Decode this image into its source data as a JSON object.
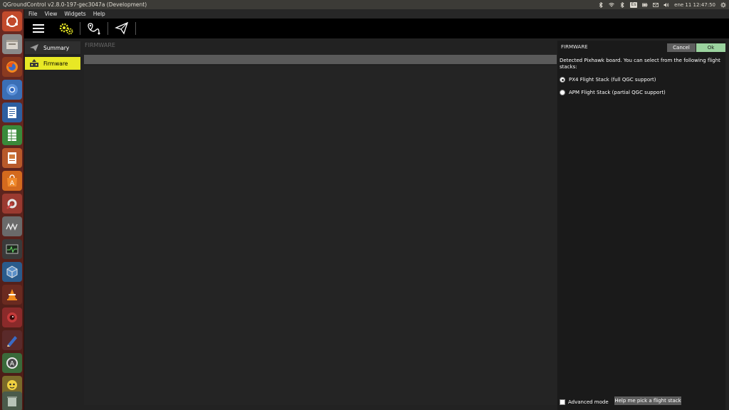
{
  "topbar": {
    "app_title": "QGroundControl v2.8.0-197-gec3047a (Development)",
    "datetime": "ene 11 12:47:50",
    "keyboard_layout": "Es"
  },
  "menubar": {
    "items": [
      "File",
      "View",
      "Widgets",
      "Help"
    ]
  },
  "toolbar": {
    "accent": "#e8e825",
    "icons": [
      "hamburger-menu-icon",
      "setup-gears-icon",
      "plan-waypoint-icon",
      "fly-paper-plane-icon"
    ]
  },
  "leftnav": {
    "items": [
      {
        "label": "Summary",
        "icon": "paper-plane-icon",
        "active": false
      },
      {
        "label": "Firmware",
        "icon": "firmware-chip-icon",
        "active": true
      }
    ],
    "active_color": "#e8e825"
  },
  "main": {
    "title": "FIRMWARE"
  },
  "dialog": {
    "title": "FIRMWARE",
    "cancel_label": "Cancel",
    "ok_label": "Ok",
    "message": "Detected Pixhawk board. You can select from the following flight stacks:",
    "options": [
      {
        "label": "PX4 Flight Stack (full QGC support)",
        "selected": true
      },
      {
        "label": "APM Flight Stack (partial QGC support)",
        "selected": false
      }
    ],
    "advanced_mode_label": "Advanced mode",
    "advanced_mode_checked": false,
    "help_label": "Help me pick a flight stack"
  }
}
